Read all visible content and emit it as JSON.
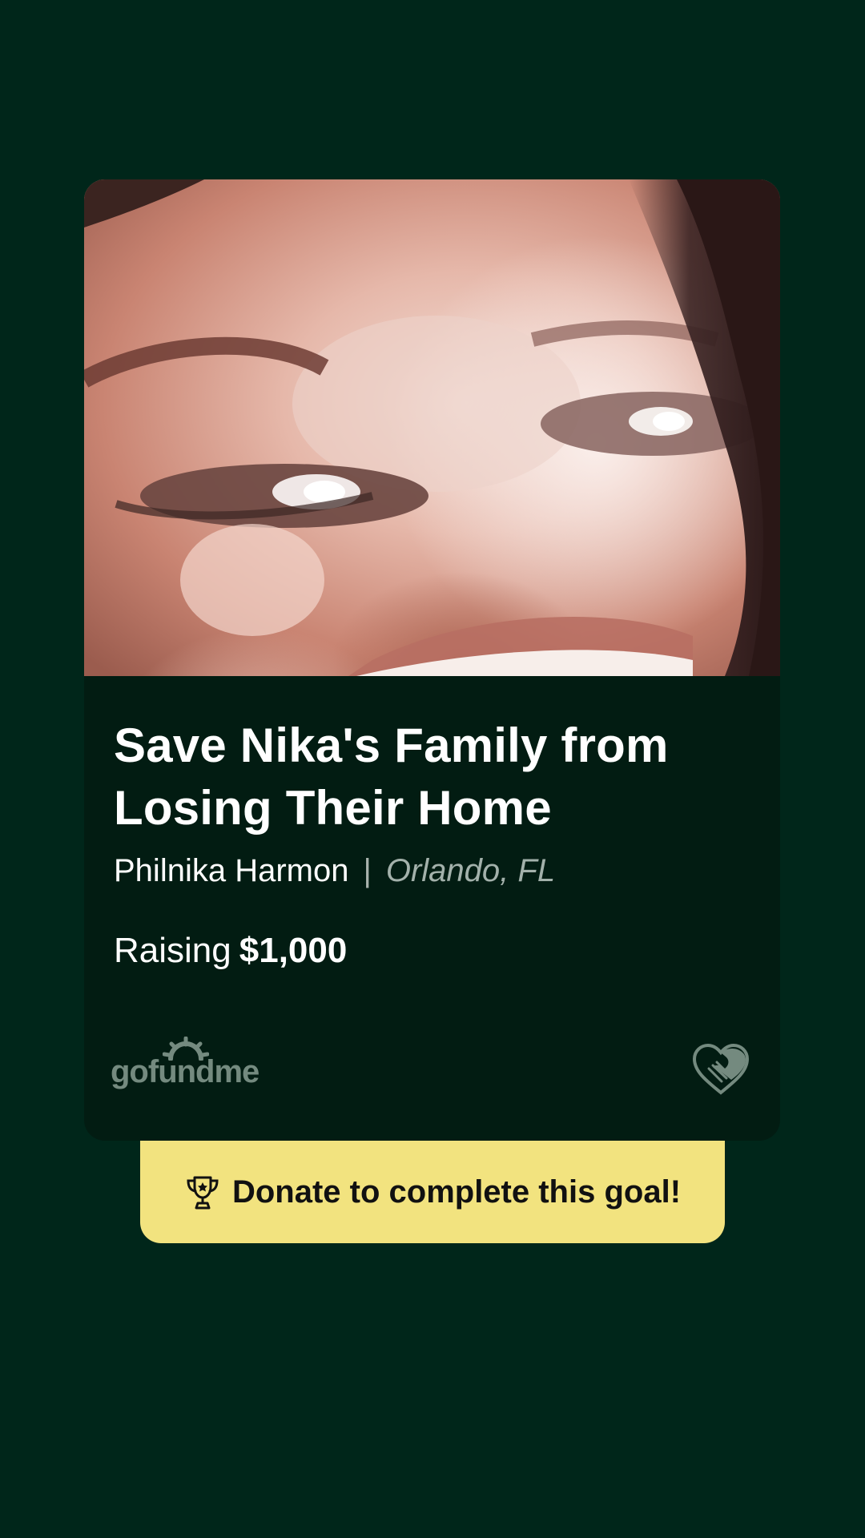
{
  "campaign": {
    "title": "Save Nika's Family from Losing Their Home",
    "organizer": "Philnika Harmon",
    "separator": "|",
    "location": "Orlando, FL",
    "raising_label": "Raising",
    "goal_amount": "$1,000"
  },
  "branding": {
    "logo_text": "gofundme",
    "logo_icon": "sun-icon",
    "heart_icon": "heart-handshake-icon"
  },
  "cta": {
    "label": "Donate to complete this goal!",
    "icon": "trophy-icon"
  },
  "colors": {
    "background": "#00261a",
    "card": "#021c12",
    "button": "#f2e37f",
    "muted_text": "#a3b1ab",
    "logo": "#748a7f"
  }
}
